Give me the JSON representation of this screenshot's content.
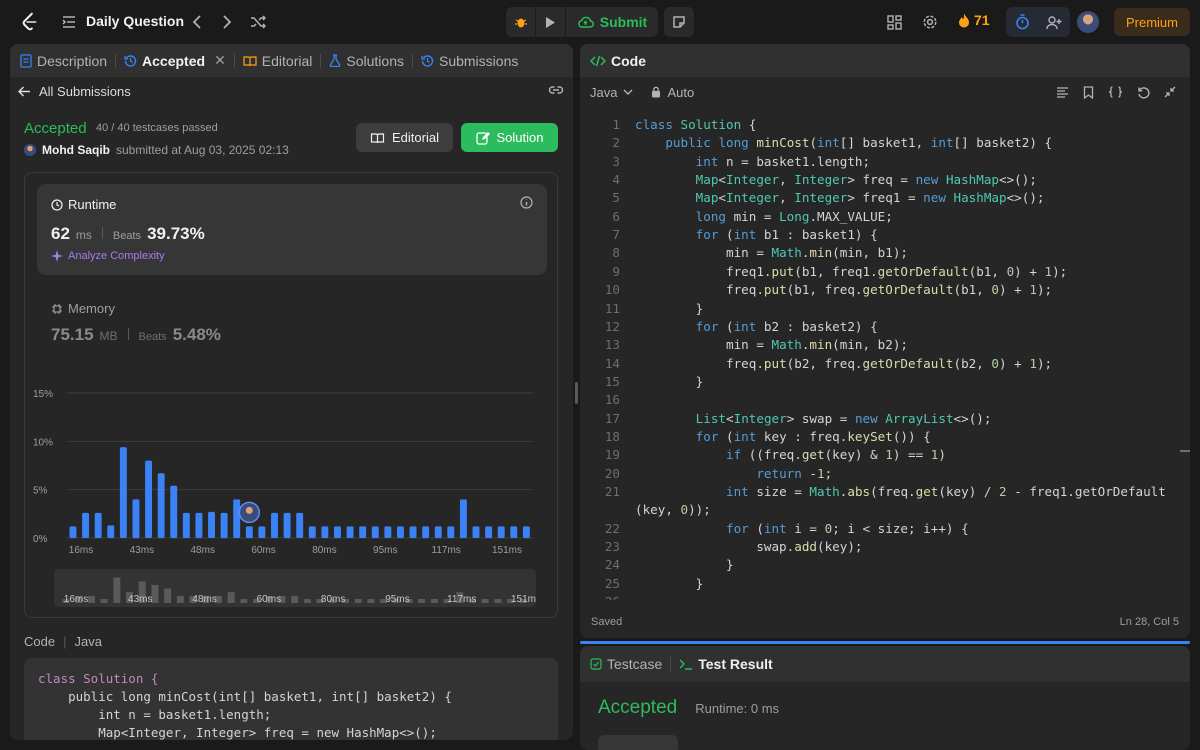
{
  "topbar": {
    "title": "Daily Question",
    "submit_label": "Submit",
    "streak_count": "71",
    "premium_label": "Premium"
  },
  "left_tabs": [
    {
      "label": "Description"
    },
    {
      "label": "Accepted"
    },
    {
      "label": "Editorial"
    },
    {
      "label": "Solutions"
    },
    {
      "label": "Submissions"
    }
  ],
  "submission": {
    "back_label": "All Submissions",
    "status": "Accepted",
    "testcases": "40 / 40 testcases passed",
    "user": "Mohd Saqib",
    "submitted_text": "submitted at Aug 03, 2025 02:13",
    "editorial_button": "Editorial",
    "solution_button": "Solution"
  },
  "runtime": {
    "label": "Runtime",
    "value": "62",
    "unit": "ms",
    "beats_label": "Beats",
    "beats_value": "39.73%",
    "analyze_label": "Analyze Complexity"
  },
  "memory": {
    "label": "Memory",
    "value": "75.15",
    "unit": "MB",
    "beats_label": "Beats",
    "beats_value": "5.48%"
  },
  "chart_data": {
    "type": "bar",
    "ylabels": [
      "15%",
      "10%",
      "5%",
      "0%"
    ],
    "xlabels": [
      "16ms",
      "43ms",
      "48ms",
      "60ms",
      "80ms",
      "95ms",
      "117ms",
      "151ms"
    ],
    "ylim": [
      0,
      15
    ],
    "values": [
      1.2,
      2.6,
      2.6,
      1.3,
      9.4,
      4.0,
      8.0,
      6.7,
      5.4,
      2.6,
      2.6,
      2.7,
      2.6,
      4.0,
      1.2,
      1.2,
      2.6,
      2.6,
      2.6,
      1.2,
      1.2,
      1.2,
      1.2,
      1.2,
      1.2,
      1.2,
      1.2,
      1.2,
      1.2,
      1.2,
      1.2,
      4.0,
      1.2,
      1.2,
      1.2,
      1.2,
      1.2
    ],
    "highlight_index": 14,
    "bar_color": "#3b82f6",
    "mini_labels": [
      "16ms",
      "43ms",
      "48ms",
      "60ms",
      "80ms",
      "95ms",
      "117ms",
      "151ms"
    ]
  },
  "code_section": {
    "label": "Code",
    "language": "Java",
    "preview_lines": [
      "class Solution {",
      "    public long minCost(int[] basket1, int[] basket2) {",
      "        int n = basket1.length;",
      "        Map<Integer, Integer> freq = new HashMap<>();"
    ]
  },
  "editor": {
    "tab_label": "Code",
    "language": "Java",
    "mode": "Auto",
    "status_left": "Saved",
    "status_right": "Ln 28, Col 5",
    "lines": [
      {
        "n": "1",
        "t": "class Solution {"
      },
      {
        "n": "2",
        "t": "    public long minCost(int[] basket1, int[] basket2) {"
      },
      {
        "n": "3",
        "t": "        int n = basket1.length;"
      },
      {
        "n": "4",
        "t": "        Map<Integer, Integer> freq = new HashMap<>();"
      },
      {
        "n": "5",
        "t": "        Map<Integer, Integer> freq1 = new HashMap<>();"
      },
      {
        "n": "6",
        "t": "        long min = Long.MAX_VALUE;"
      },
      {
        "n": "7",
        "t": "        for (int b1 : basket1) {"
      },
      {
        "n": "8",
        "t": "            min = Math.min(min, b1);"
      },
      {
        "n": "9",
        "t": "            freq1.put(b1, freq1.getOrDefault(b1, 0) + 1);"
      },
      {
        "n": "10",
        "t": "            freq.put(b1, freq.getOrDefault(b1, 0) + 1);"
      },
      {
        "n": "11",
        "t": "        }"
      },
      {
        "n": "12",
        "t": "        for (int b2 : basket2) {"
      },
      {
        "n": "13",
        "t": "            min = Math.min(min, b2);"
      },
      {
        "n": "14",
        "t": "            freq.put(b2, freq.getOrDefault(b2, 0) + 1);"
      },
      {
        "n": "15",
        "t": "        }"
      },
      {
        "n": "16",
        "t": ""
      },
      {
        "n": "17",
        "t": "        List<Integer> swap = new ArrayList<>();"
      },
      {
        "n": "18",
        "t": "        for (int key : freq.keySet()) {"
      },
      {
        "n": "19",
        "t": "            if ((freq.get(key) & 1) == 1)"
      },
      {
        "n": "20",
        "t": "                return -1;"
      },
      {
        "n": "21",
        "t": "            int size = Math.abs(freq.get(key) / 2 - freq1.getOrDefault"
      },
      {
        "n": "",
        "t": "(key, 0));"
      },
      {
        "n": "22",
        "t": "            for (int i = 0; i < size; i++) {"
      },
      {
        "n": "23",
        "t": "                swap.add(key);"
      },
      {
        "n": "24",
        "t": "            }"
      },
      {
        "n": "25",
        "t": "        }"
      },
      {
        "n": "26",
        "t": ""
      }
    ]
  },
  "result": {
    "testcase_tab": "Testcase",
    "result_tab": "Test Result",
    "status": "Accepted",
    "runtime": "Runtime: 0 ms"
  }
}
